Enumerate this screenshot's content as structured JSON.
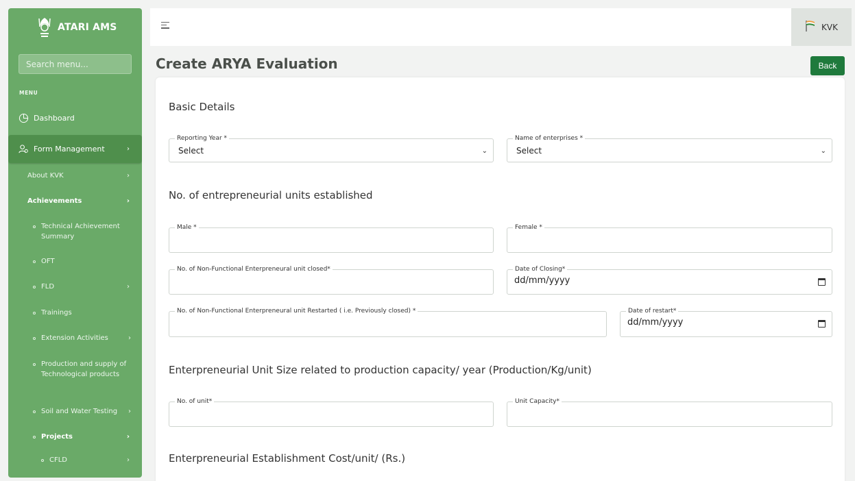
{
  "sidebar": {
    "brand": "ATARI AMS",
    "search_placeholder": "Search menu...",
    "menu_label": "MENU",
    "items": {
      "dashboard": "Dashboard",
      "form_management": "Form Management",
      "about_kvk": "About KVK",
      "achievements": "Achievements",
      "technical_achievement": "Technical Achievement Summary",
      "oft": "OFT",
      "fld": "FLD",
      "trainings": "Trainings",
      "extension": "Extension Activities",
      "production": "Production and supply of Technological products",
      "soil": "Soil and Water Testing",
      "projects": "Projects",
      "cfld": "CFLD"
    }
  },
  "topbar": {
    "user": "KVK"
  },
  "page": {
    "title": "Create ARYA Evaluation",
    "back": "Back"
  },
  "form": {
    "basic_details": "Basic Details",
    "reporting_year": {
      "label": "Reporting Year *",
      "value": "Select"
    },
    "enterprise": {
      "label": "Name of enterprises *",
      "value": "Select"
    },
    "units_established": "No. of entrepreneurial units established",
    "male": {
      "label": "Male *",
      "value": ""
    },
    "female": {
      "label": "Female *",
      "value": ""
    },
    "nonfunc_closed": {
      "label": "No. of Non-Functional Enterpreneural unit closed*",
      "value": ""
    },
    "date_closing": {
      "label": "Date of Closing*",
      "value": "dd/mm/yyyy"
    },
    "nonfunc_restarted": {
      "label": "No. of Non-Functional Enterpreneural unit Restarted ( i.e. Previously closed) *",
      "value": ""
    },
    "date_restart": {
      "label": "Date of restart*",
      "value": "dd/mm/yyyy"
    },
    "unit_size": "Enterpreneurial Unit Size related to production capacity/ year (Production/Kg/unit)",
    "no_of_unit": {
      "label": "No. of unit*",
      "value": ""
    },
    "unit_capacity": {
      "label": "Unit Capacity*",
      "value": ""
    },
    "establishment_cost": "Enterpreneurial Establishment Cost/unit/ (Rs.)"
  }
}
